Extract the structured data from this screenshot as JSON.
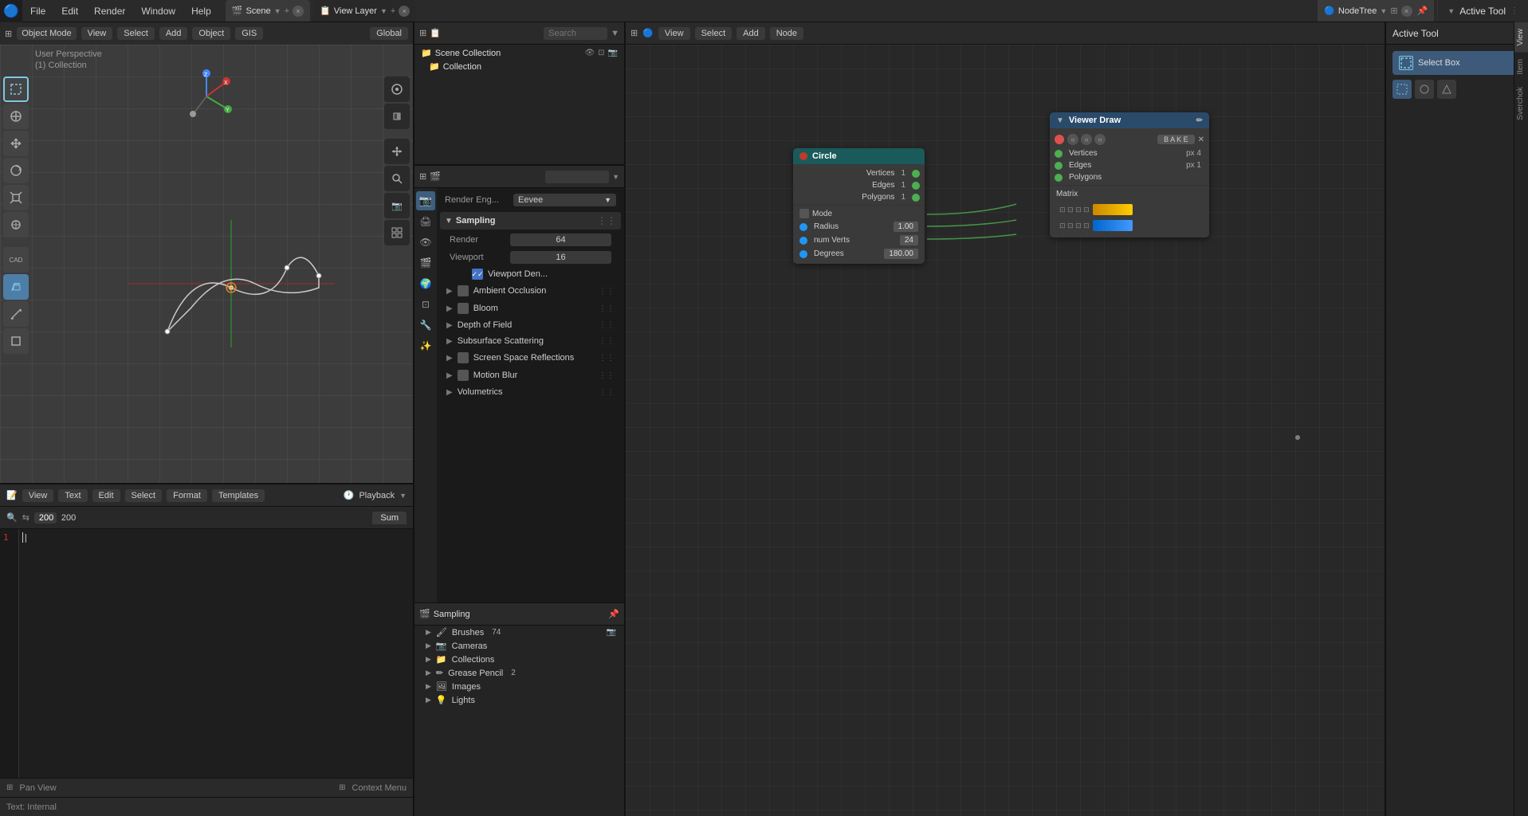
{
  "app": {
    "title": "Blender",
    "logo": "🔵"
  },
  "top_menu": {
    "items": [
      "File",
      "Edit",
      "Render",
      "Window",
      "Help"
    ]
  },
  "scene_tab": {
    "icon": "🎬",
    "name": "Scene",
    "close": "×"
  },
  "view_layer_tab": {
    "icon": "📋",
    "name": "View Layer",
    "close": "×"
  },
  "node_tree_tab": {
    "icon": "🔵",
    "name": "NodeTree",
    "close": "×"
  },
  "active_tool": {
    "label": "Active Tool",
    "button_label": "Select Box"
  },
  "viewport": {
    "mode": "Object Mode",
    "view_label": "View",
    "select_label": "Select",
    "add_label": "Add",
    "object_label": "Object",
    "gis_label": "GIS",
    "global_label": "Global",
    "perspective": "User Perspective",
    "collection": "(1) Collection"
  },
  "outliner": {
    "search_placeholder": "Search",
    "items": [
      {
        "label": "Scene Collection",
        "icon": "📁",
        "indent": 0
      },
      {
        "label": "Collection",
        "icon": "📁",
        "indent": 1
      },
      {
        "label": "Brushes",
        "count": "74",
        "indent": 1
      },
      {
        "label": "Cameras",
        "indent": 1
      },
      {
        "label": "Collections",
        "indent": 1
      },
      {
        "label": "Grease Pencil",
        "count": "2",
        "indent": 1
      },
      {
        "label": "Images",
        "indent": 1
      },
      {
        "label": "Lights",
        "indent": 1
      }
    ]
  },
  "properties": {
    "render_engine_label": "Render Eng...",
    "render_engine_value": "Eevee",
    "sampling": {
      "label": "Sampling",
      "render_label": "Render",
      "render_value": "64",
      "viewport_label": "Viewport",
      "viewport_value": "16",
      "viewport_denoising_label": "Viewport Den...",
      "viewport_denoising_checked": true
    },
    "sections": [
      {
        "label": "Ambient Occlusion",
        "has_checkbox": true,
        "checked": false
      },
      {
        "label": "Bloom",
        "has_checkbox": true,
        "checked": false
      },
      {
        "label": "Depth of Field",
        "has_checkbox": false
      },
      {
        "label": "Subsurface Scattering",
        "has_checkbox": false
      },
      {
        "label": "Screen Space Reflections",
        "has_checkbox": true,
        "checked": false
      },
      {
        "label": "Motion Blur",
        "has_checkbox": true,
        "checked": false
      },
      {
        "label": "Volumetrics",
        "has_checkbox": false
      }
    ]
  },
  "text_editor": {
    "view_label": "View",
    "text_label": "Text",
    "edit_label": "Edit",
    "select_label": "Select",
    "format_label": "Format",
    "templates_label": "Templates",
    "playback_label": "Playback",
    "frame_value": "200",
    "internal_label": "Text: Internal",
    "pan_view_label": "Pan View",
    "context_menu_label": "Context Menu",
    "script_name": "Sum",
    "line_number": "1"
  },
  "nodes": {
    "circle_node": {
      "title": "Circle",
      "color": "#c0392b",
      "sockets": [
        {
          "label": "Vertices",
          "value": "1"
        },
        {
          "label": "Edges",
          "value": "1"
        },
        {
          "label": "Polygons",
          "value": "1"
        }
      ],
      "mode_label": "Mode",
      "radius_label": "Radius",
      "radius_value": "1.00",
      "numverts_label": "num Verts",
      "numverts_value": "24",
      "degrees_label": "Degrees",
      "degrees_value": "180.00"
    },
    "viewer_node": {
      "title": "Viewer Draw",
      "bake_label": "B A K E",
      "sockets": [
        {
          "label": "Vertices",
          "extra": "px  4"
        },
        {
          "label": "Edges",
          "extra": "px  1"
        },
        {
          "label": "Polygons"
        }
      ],
      "matrix_label": "Matrix"
    }
  }
}
